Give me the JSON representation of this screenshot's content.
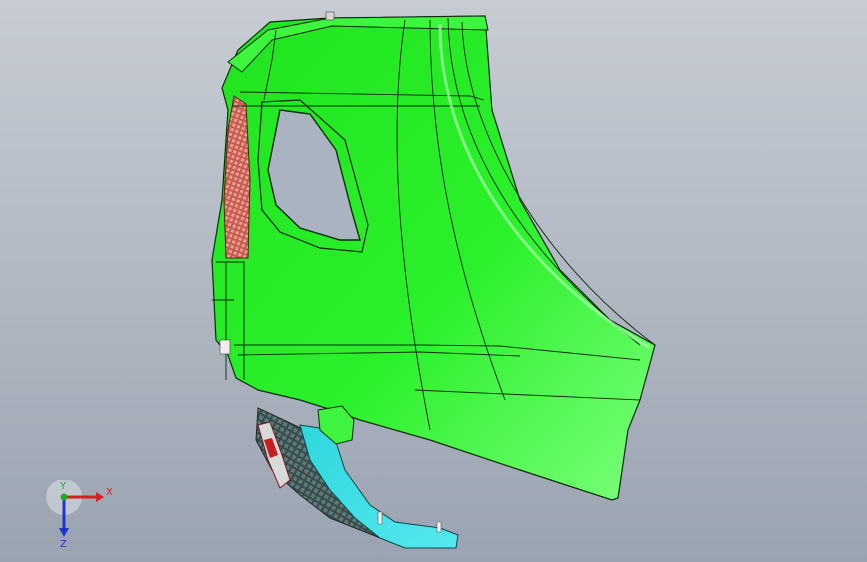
{
  "viewport": {
    "background_top": "#c7ccd3",
    "background_bottom": "#9aa3b1",
    "model": {
      "main_part_color": "#22ee22",
      "bracket_color": "#33dddd",
      "lamp_color": "#e07a6a",
      "edge_color": "#0b2a0b"
    }
  },
  "triad": {
    "x_label": "X",
    "y_label": "Y",
    "z_label": "Z",
    "x_color": "#d42020",
    "y_color": "#22aa22",
    "z_color": "#2233cc"
  }
}
